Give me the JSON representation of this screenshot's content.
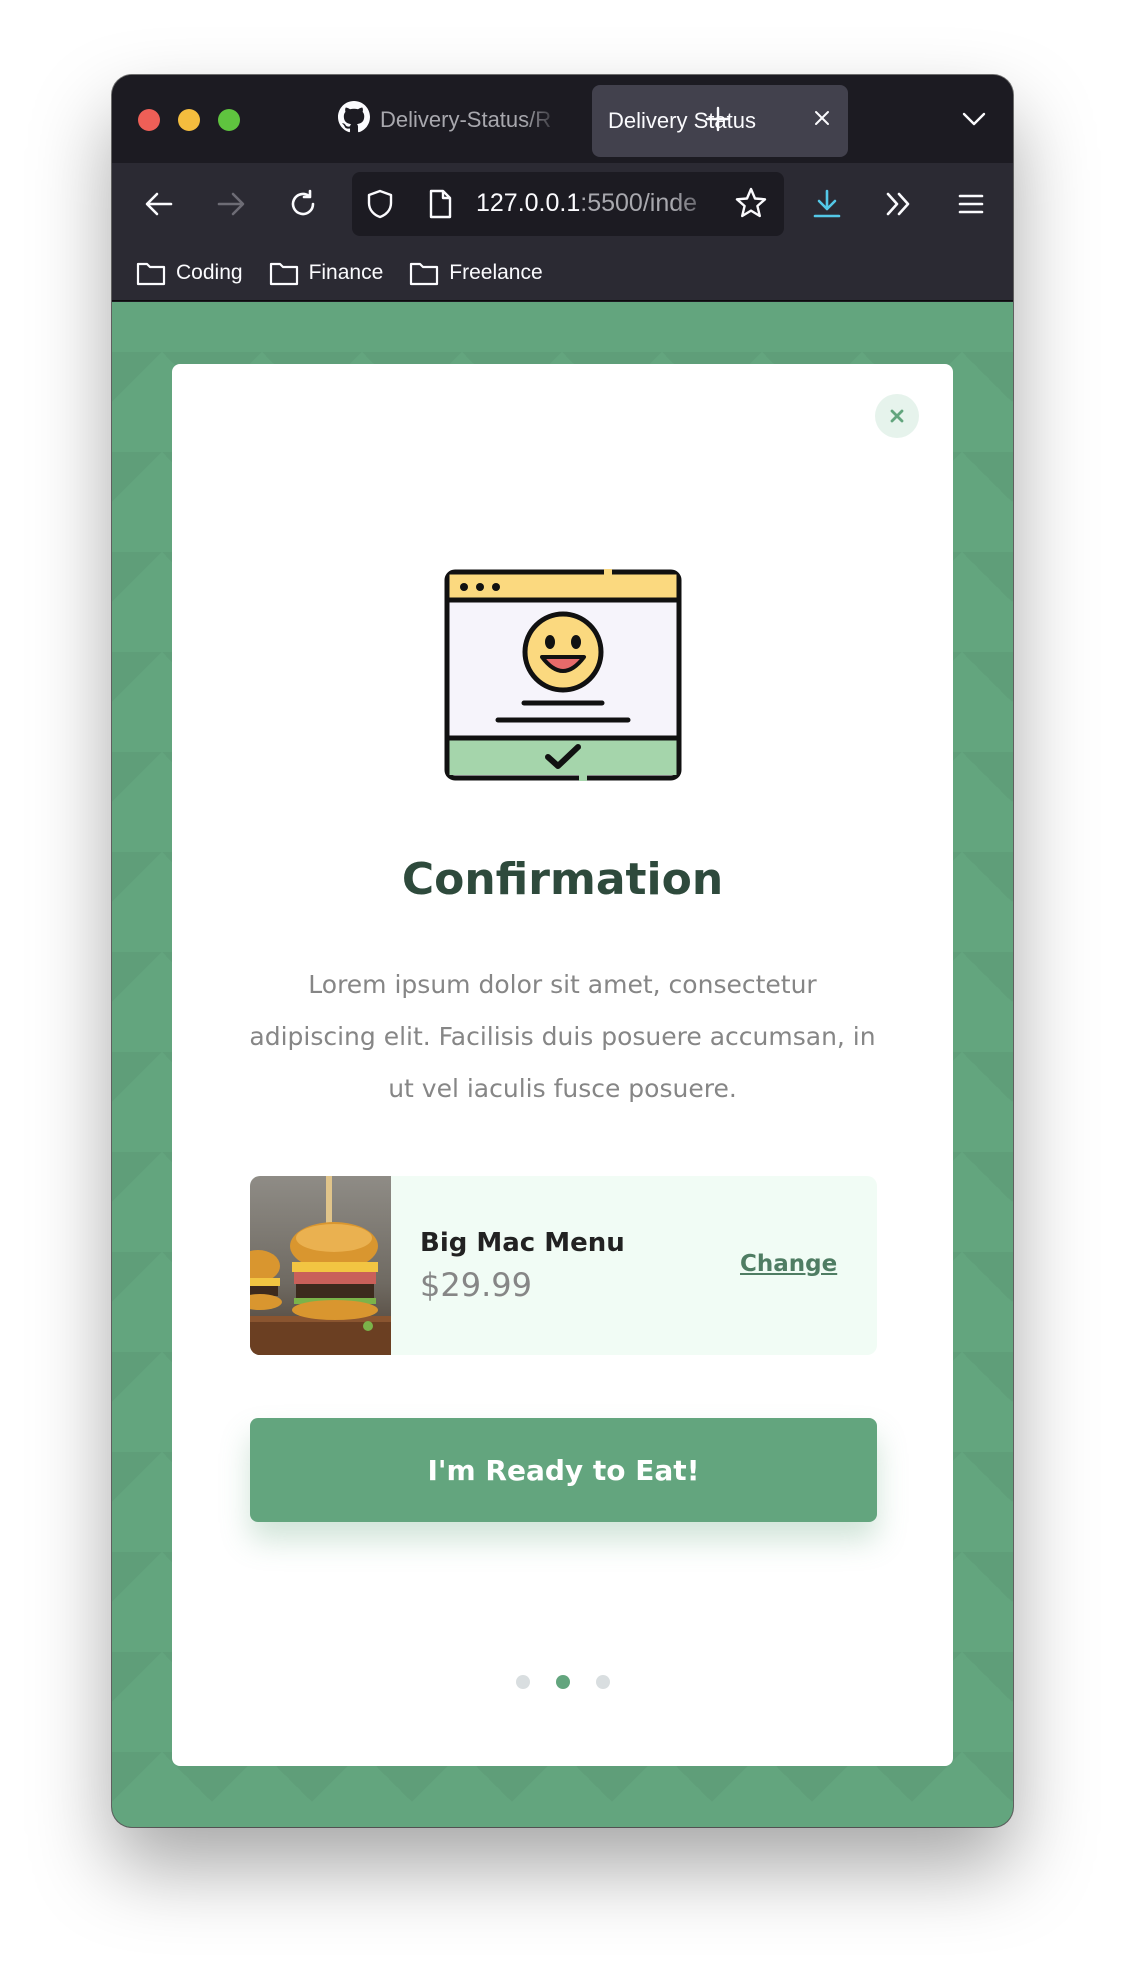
{
  "browser": {
    "tabs": [
      {
        "label": "Delivery-Status/R",
        "icon": "github-icon",
        "active": false
      },
      {
        "label": "Delivery Status",
        "active": true
      }
    ],
    "url": {
      "host": "127.0.0.1",
      "rest": ":5500/inde"
    },
    "bookmarks": [
      {
        "label": "Coding",
        "icon": "folder-icon"
      },
      {
        "label": "Finance",
        "icon": "folder-icon"
      },
      {
        "label": "Freelance",
        "icon": "folder-icon"
      }
    ],
    "colors": {
      "chrome": "#1c1b22",
      "toolbar": "#2b2a33",
      "download_accent": "#54c8e8"
    }
  },
  "modal": {
    "title": "Confirmation",
    "description": "Lorem ipsum dolor sit amet, consectetur adipiscing elit. Facilisis duis posuere accumsan, in ut vel iaculis fusce posuere.",
    "order": {
      "name": "Big Mac Menu",
      "price": "$29.99",
      "change_label": "Change",
      "image": "burger-photo"
    },
    "cta_label": "I'm Ready to Eat!",
    "pagination": {
      "total": 3,
      "active_index": 1
    },
    "colors": {
      "accent": "#63a57e",
      "title": "#2e4a3c",
      "text": "#868686",
      "order_bg": "#f1fcf5"
    }
  }
}
